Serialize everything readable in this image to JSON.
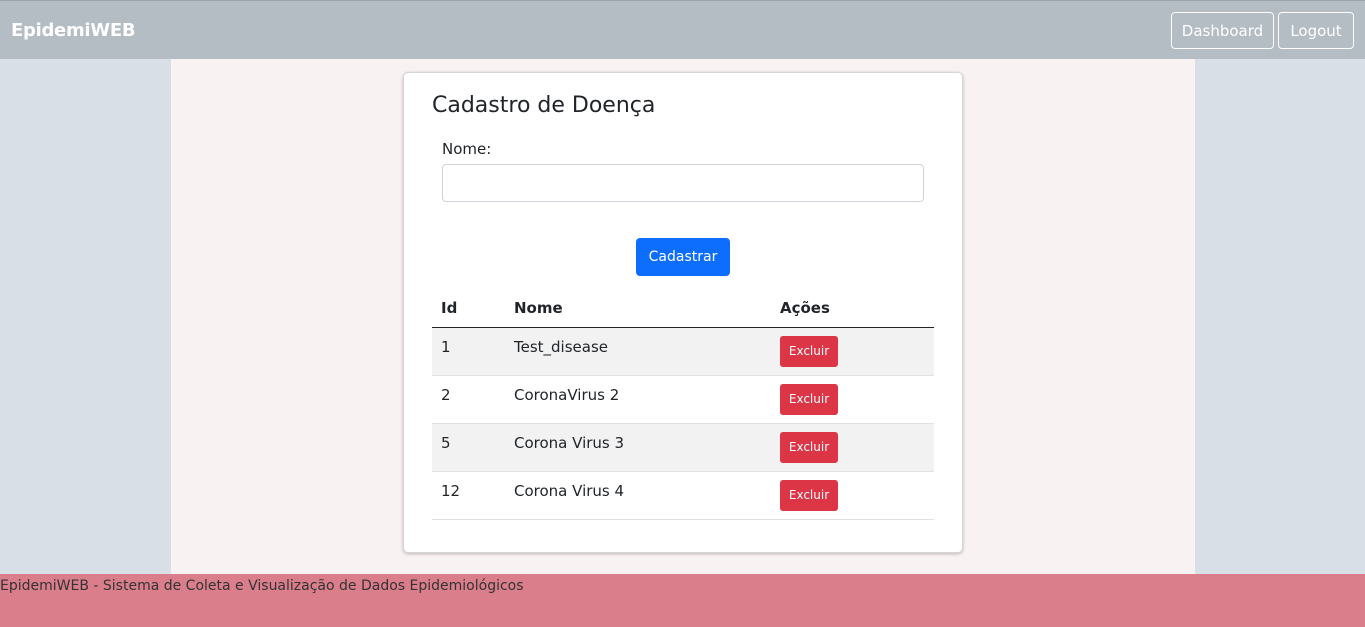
{
  "navbar": {
    "brand": "EpidemiWEB",
    "dashboard_label": "Dashboard",
    "logout_label": "Logout"
  },
  "form": {
    "title": "Cadastro de Doença",
    "name_label": "Nome:",
    "name_value": "",
    "submit_label": "Cadastrar"
  },
  "table": {
    "headers": [
      "Id",
      "Nome",
      "Ações"
    ],
    "rows": [
      {
        "id": "1",
        "name": "Test_disease",
        "action": "Excluir"
      },
      {
        "id": "2",
        "name": "CoronaVirus 2",
        "action": "Excluir"
      },
      {
        "id": "5",
        "name": "Corona Virus 3",
        "action": "Excluir"
      },
      {
        "id": "12",
        "name": "Corona Virus 4",
        "action": "Excluir"
      }
    ]
  },
  "footer": {
    "text": "EpidemiWEB - Sistema de Coleta e Visualização de Dados Epidemiológicos"
  },
  "colors": {
    "navbar": "#b4bcc4",
    "primary": "#0d6efd",
    "danger": "#dc3545",
    "footer": "#db7e8c"
  }
}
